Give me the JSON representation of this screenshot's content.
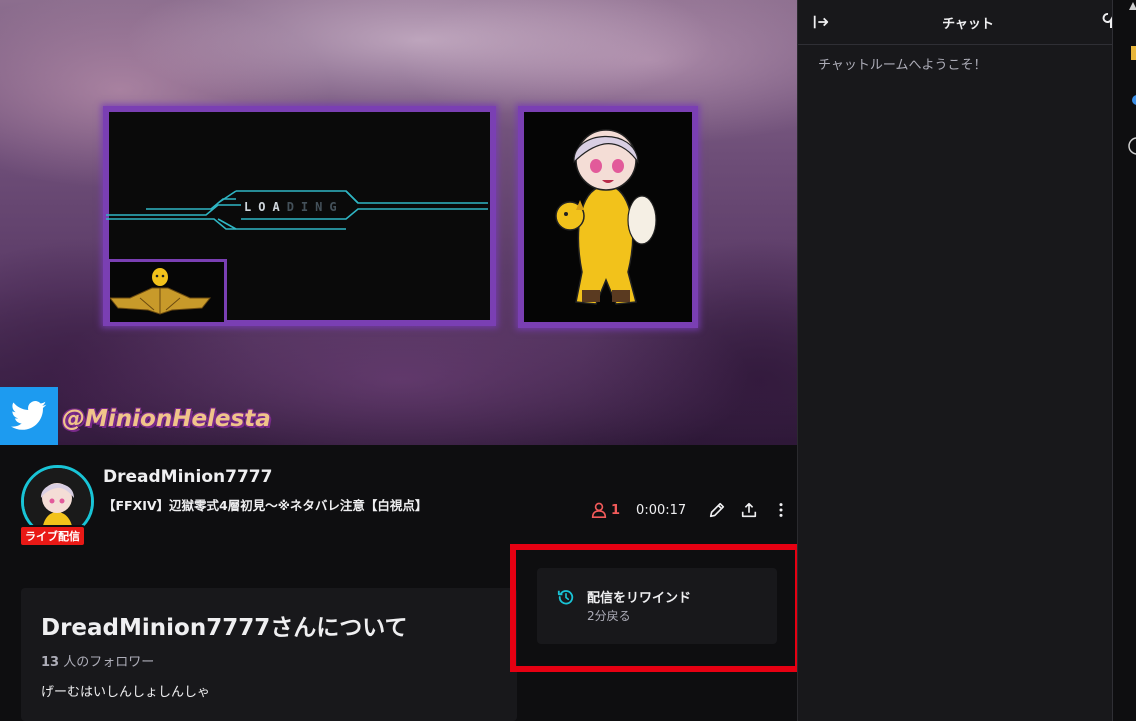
{
  "player": {
    "loading_bright": "LOA",
    "loading_dim": "DING",
    "twitter_handle": "@MinionHelesta"
  },
  "channel": {
    "name": "DreadMinion7777",
    "stream_title": "【FFXIV】辺獄零式4層初見～※ネタバレ注意【白視点】",
    "live_badge": "ライブ配信",
    "viewer_count": "1",
    "uptime": "0:00:17"
  },
  "about": {
    "title": "DreadMinion7777さんについて",
    "followers_count": "13",
    "followers_label": " 人のフォロワー",
    "bio": "げーむはいしんしょしんしゃ"
  },
  "rewind": {
    "title": "配信をリワインド",
    "subtitle": "2分戻る"
  },
  "chat": {
    "title": "チャット",
    "welcome": "チャットルームへようこそ！"
  },
  "colors": {
    "background": "#0e0e10",
    "card": "#18181b",
    "accent_cyan": "#19c4d6",
    "live_red": "#e91916",
    "highlight_red": "#e60012",
    "twitter_blue": "#1d9bf0"
  },
  "icons": [
    "twitter-icon",
    "viewer-icon",
    "edit-icon",
    "share-icon",
    "more-icon",
    "rewind-icon",
    "collapse-chat-icon",
    "chat-settings-icon"
  ]
}
